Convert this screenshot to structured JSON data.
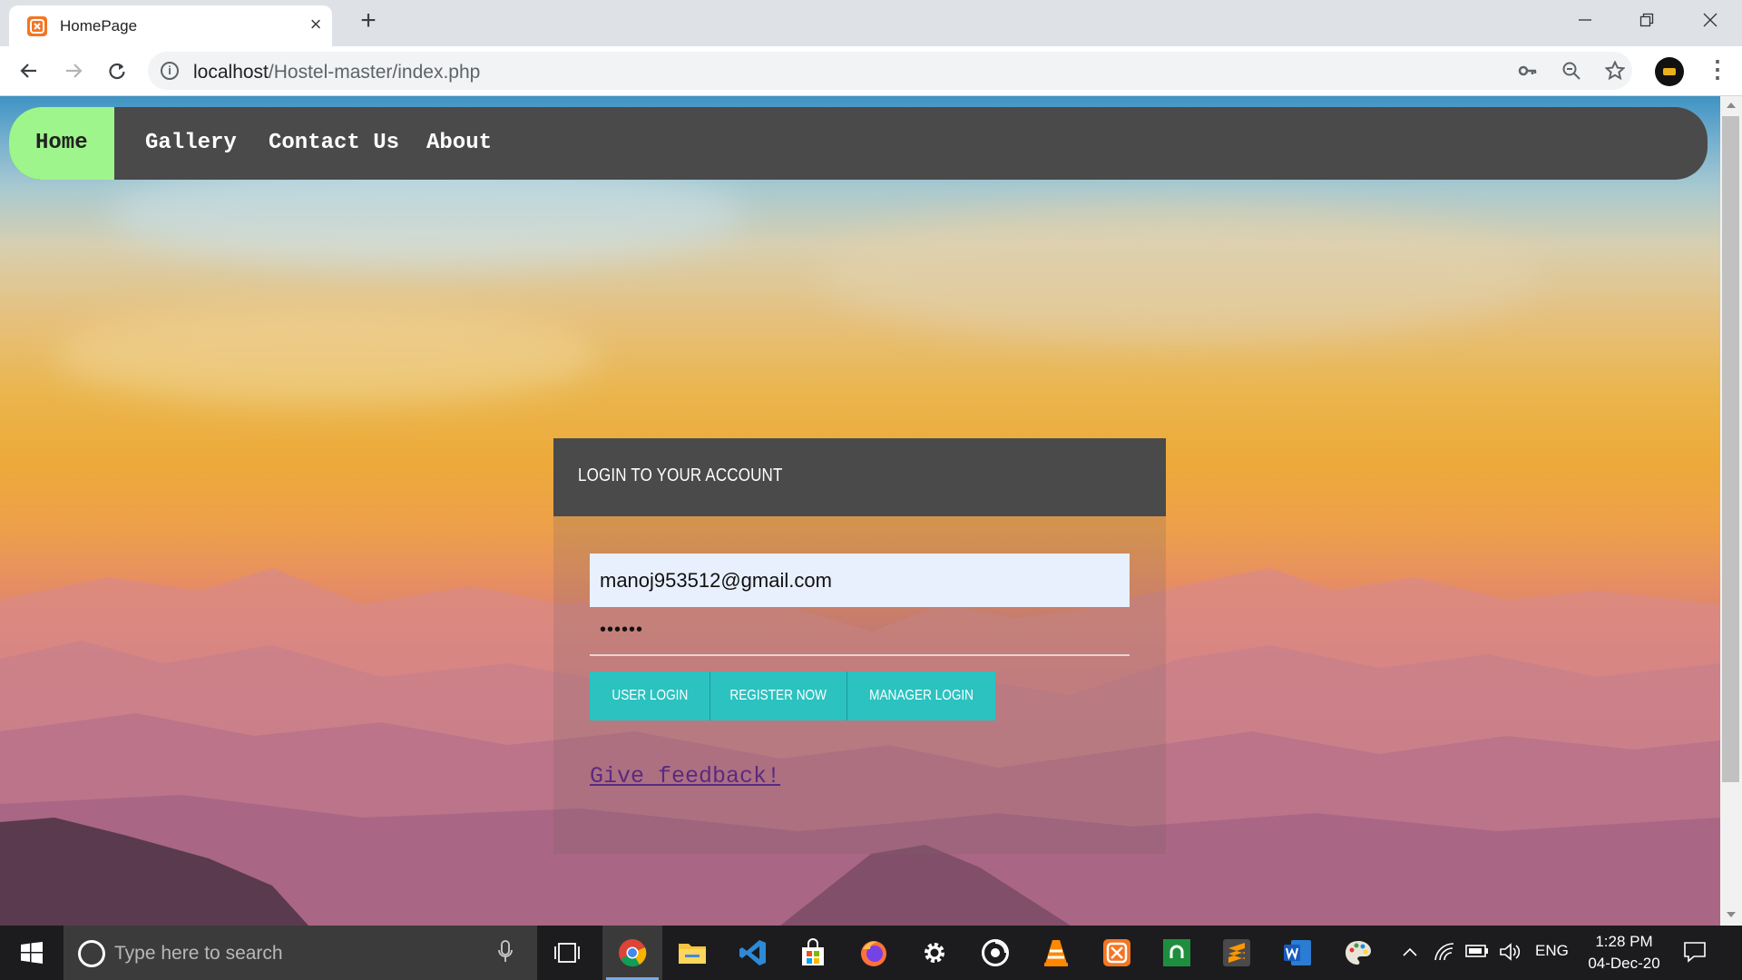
{
  "browser": {
    "tab_title": "HomePage",
    "url_host": "localhost",
    "url_path": "/Hostel-master/index.php"
  },
  "nav": {
    "items": [
      {
        "label": "Home",
        "active": true
      },
      {
        "label": "Gallery",
        "active": false
      },
      {
        "label": "Contact Us",
        "active": false
      },
      {
        "label": "About",
        "active": false
      }
    ]
  },
  "login": {
    "heading": "LOGIN TO YOUR ACCOUNT",
    "email_value": "manoj953512@gmail.com",
    "password_mask": "••••••",
    "buttons": {
      "user_login": "USER LOGIN",
      "register": "REGISTER NOW",
      "manager_login": "MANAGER LOGIN"
    },
    "feedback_link": "Give feedback!"
  },
  "taskbar": {
    "search_placeholder": "Type here to search",
    "language": "ENG",
    "time": "1:28 PM",
    "date": "04-Dec-20"
  },
  "colors": {
    "nav_bg": "#4a4a4a",
    "nav_active": "#9ef58b",
    "button_teal": "#2bc2c0",
    "feedback_link": "#5a2a80"
  }
}
